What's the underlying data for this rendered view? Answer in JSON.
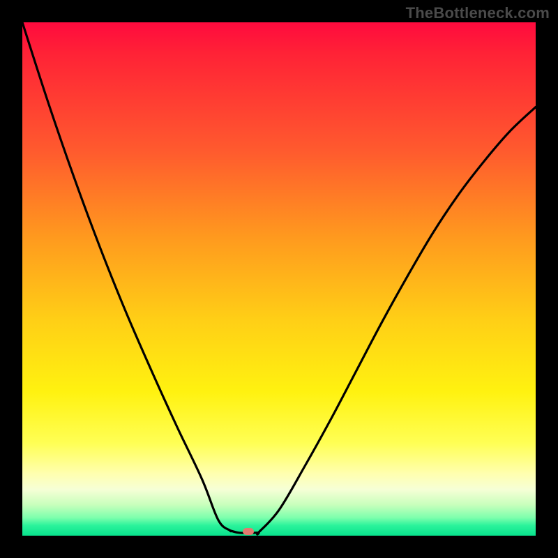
{
  "watermark": {
    "text": "TheBottleneck.com"
  },
  "colors": {
    "frame": "#000000",
    "marker": "#e47a6f",
    "curve": "#000000"
  },
  "chart_data": {
    "type": "line",
    "title": "",
    "xlabel": "",
    "ylabel": "",
    "xlim": [
      0,
      1
    ],
    "ylim": [
      0,
      1
    ],
    "grid": false,
    "legend": false,
    "series": [
      {
        "name": "left-branch",
        "x": [
          0.0,
          0.05,
          0.1,
          0.15,
          0.2,
          0.25,
          0.3,
          0.35,
          0.382,
          0.405
        ],
        "y": [
          1.0,
          0.845,
          0.7,
          0.565,
          0.44,
          0.325,
          0.215,
          0.11,
          0.03,
          0.01
        ]
      },
      {
        "name": "valley-floor",
        "x": [
          0.405,
          0.42,
          0.44,
          0.46
        ],
        "y": [
          0.01,
          0.006,
          0.005,
          0.006
        ]
      },
      {
        "name": "right-branch",
        "x": [
          0.46,
          0.5,
          0.55,
          0.6,
          0.65,
          0.7,
          0.75,
          0.8,
          0.85,
          0.9,
          0.95,
          1.0
        ],
        "y": [
          0.006,
          0.05,
          0.135,
          0.225,
          0.32,
          0.415,
          0.505,
          0.59,
          0.665,
          0.73,
          0.788,
          0.835
        ]
      }
    ],
    "annotations": [
      {
        "name": "optimum-marker",
        "x": 0.44,
        "y": 0.008
      }
    ]
  }
}
